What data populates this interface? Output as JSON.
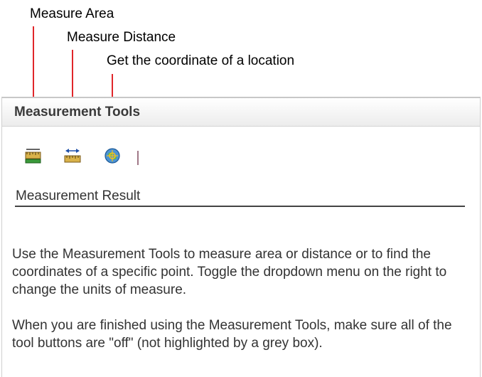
{
  "callouts": {
    "measure_area": "Measure Area",
    "measure_distance": "Measure Distance",
    "get_coordinate": "Get the coordinate of a location"
  },
  "panel": {
    "title": "Measurement Tools",
    "toolbar": [
      {
        "icon": "measure-area-icon",
        "tooltip": "Measure Area"
      },
      {
        "icon": "measure-distance-icon",
        "tooltip": "Measure Distance"
      },
      {
        "icon": "location-coordinate-icon",
        "tooltip": "Get the coordinate of a location"
      }
    ],
    "result_label": "Measurement Result",
    "paragraph_1": "Use the Measurement Tools to measure area or distance or to find the coordinates of a specific point. Toggle the dropdown menu on the right to change the units of measure.",
    "paragraph_2": "When you are finished using the Measurement Tools, make sure all of the tool buttons are \"off\" (not highlighted by a grey box)."
  },
  "colors": {
    "leader_line": "#e0262a",
    "ruler": "#b58a2a",
    "globe": "#3a86c8"
  }
}
